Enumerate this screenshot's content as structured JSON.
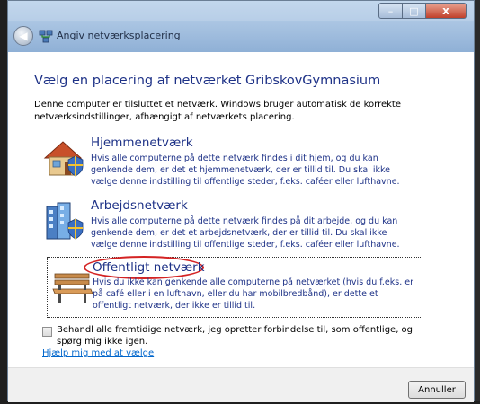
{
  "window": {
    "title": "Angiv netværksplacering",
    "caption_buttons": {
      "minimize": "–",
      "maximize": "□",
      "close": "x"
    },
    "back_icon": "back-arrow-icon",
    "title_icon": "network-icon"
  },
  "content": {
    "heading": "Vælg en placering af netværket GribskovGymnasium",
    "intro": "Denne computer er tilsluttet et netværk. Windows bruger automatisk de korrekte netværksindstillinger, afhængigt af netværkets placering.",
    "options": [
      {
        "title": "Hjemmenetværk",
        "description": "Hvis alle computerne på dette netværk findes i dit hjem, og du kan genkende dem, er det et hjemmenetværk, der er tillid til. Du skal ikke vælge denne indstilling til offentlige steder, f.eks. caféer eller lufthavne.",
        "icon": "house-icon"
      },
      {
        "title": "Arbejdsnetværk",
        "description": "Hvis alle computerne på dette netværk findes på dit arbejde, og du kan genkende dem, er det et arbejdsnetværk, der er tillid til. Du skal ikke vælge denne indstilling til offentlige steder, f.eks. caféer eller lufthavne.",
        "icon": "office-building-icon"
      },
      {
        "title": "Offentligt netværk",
        "description": "Hvis du ikke kan genkende alle computerne på netværket (hvis du f.eks. er på café eller i en lufthavn, eller du har mobilbredbånd), er dette et offentligt netværk, der ikke er tillid til.",
        "icon": "park-bench-icon"
      }
    ],
    "checkbox_label": "Behandl alle fremtidige netværk, jeg opretter forbindelse til, som offentlige, og spørg mig ikke igen.",
    "checkbox_checked": false,
    "help_link": "Hjælp mig med at vælge"
  },
  "footer": {
    "cancel_label": "Annuller"
  },
  "colors": {
    "heading": "#1e3287",
    "link": "#0066cc",
    "annotation": "#d42323"
  }
}
